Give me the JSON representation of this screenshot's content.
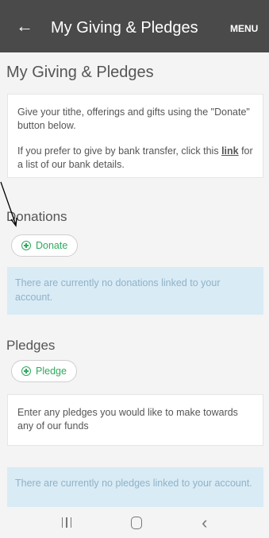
{
  "header": {
    "back_icon": "arrow-left-icon",
    "title": "My Giving & Pledges",
    "menu_label": "MENU"
  },
  "main": {
    "title": "My Giving & Pledges",
    "intro": {
      "line1": "Give your tithe, offerings and gifts using the \"Donate\" button below.",
      "line2_before": "If you prefer to give by bank transfer, click this ",
      "link_label": "link",
      "line2_after": " for a list of our bank details."
    },
    "donations": {
      "heading": "Donations",
      "button_label": "Donate",
      "empty_message": "There are currently no donations linked to your account."
    },
    "pledges": {
      "heading": "Pledges",
      "button_label": "Pledge",
      "info_text": "Enter any pledges you would like to make towards any of our funds",
      "empty_message": "There are currently no pledges linked to your account."
    }
  },
  "colors": {
    "topbar": "#4a4a4a",
    "accent_green": "#2eaa5c",
    "alert_background": "#d9ebf5",
    "alert_text": "#8fb3c8"
  },
  "system_nav": {
    "recents_icon": "recents-icon",
    "home_icon": "home-icon",
    "back_icon": "chevron-left-icon"
  }
}
